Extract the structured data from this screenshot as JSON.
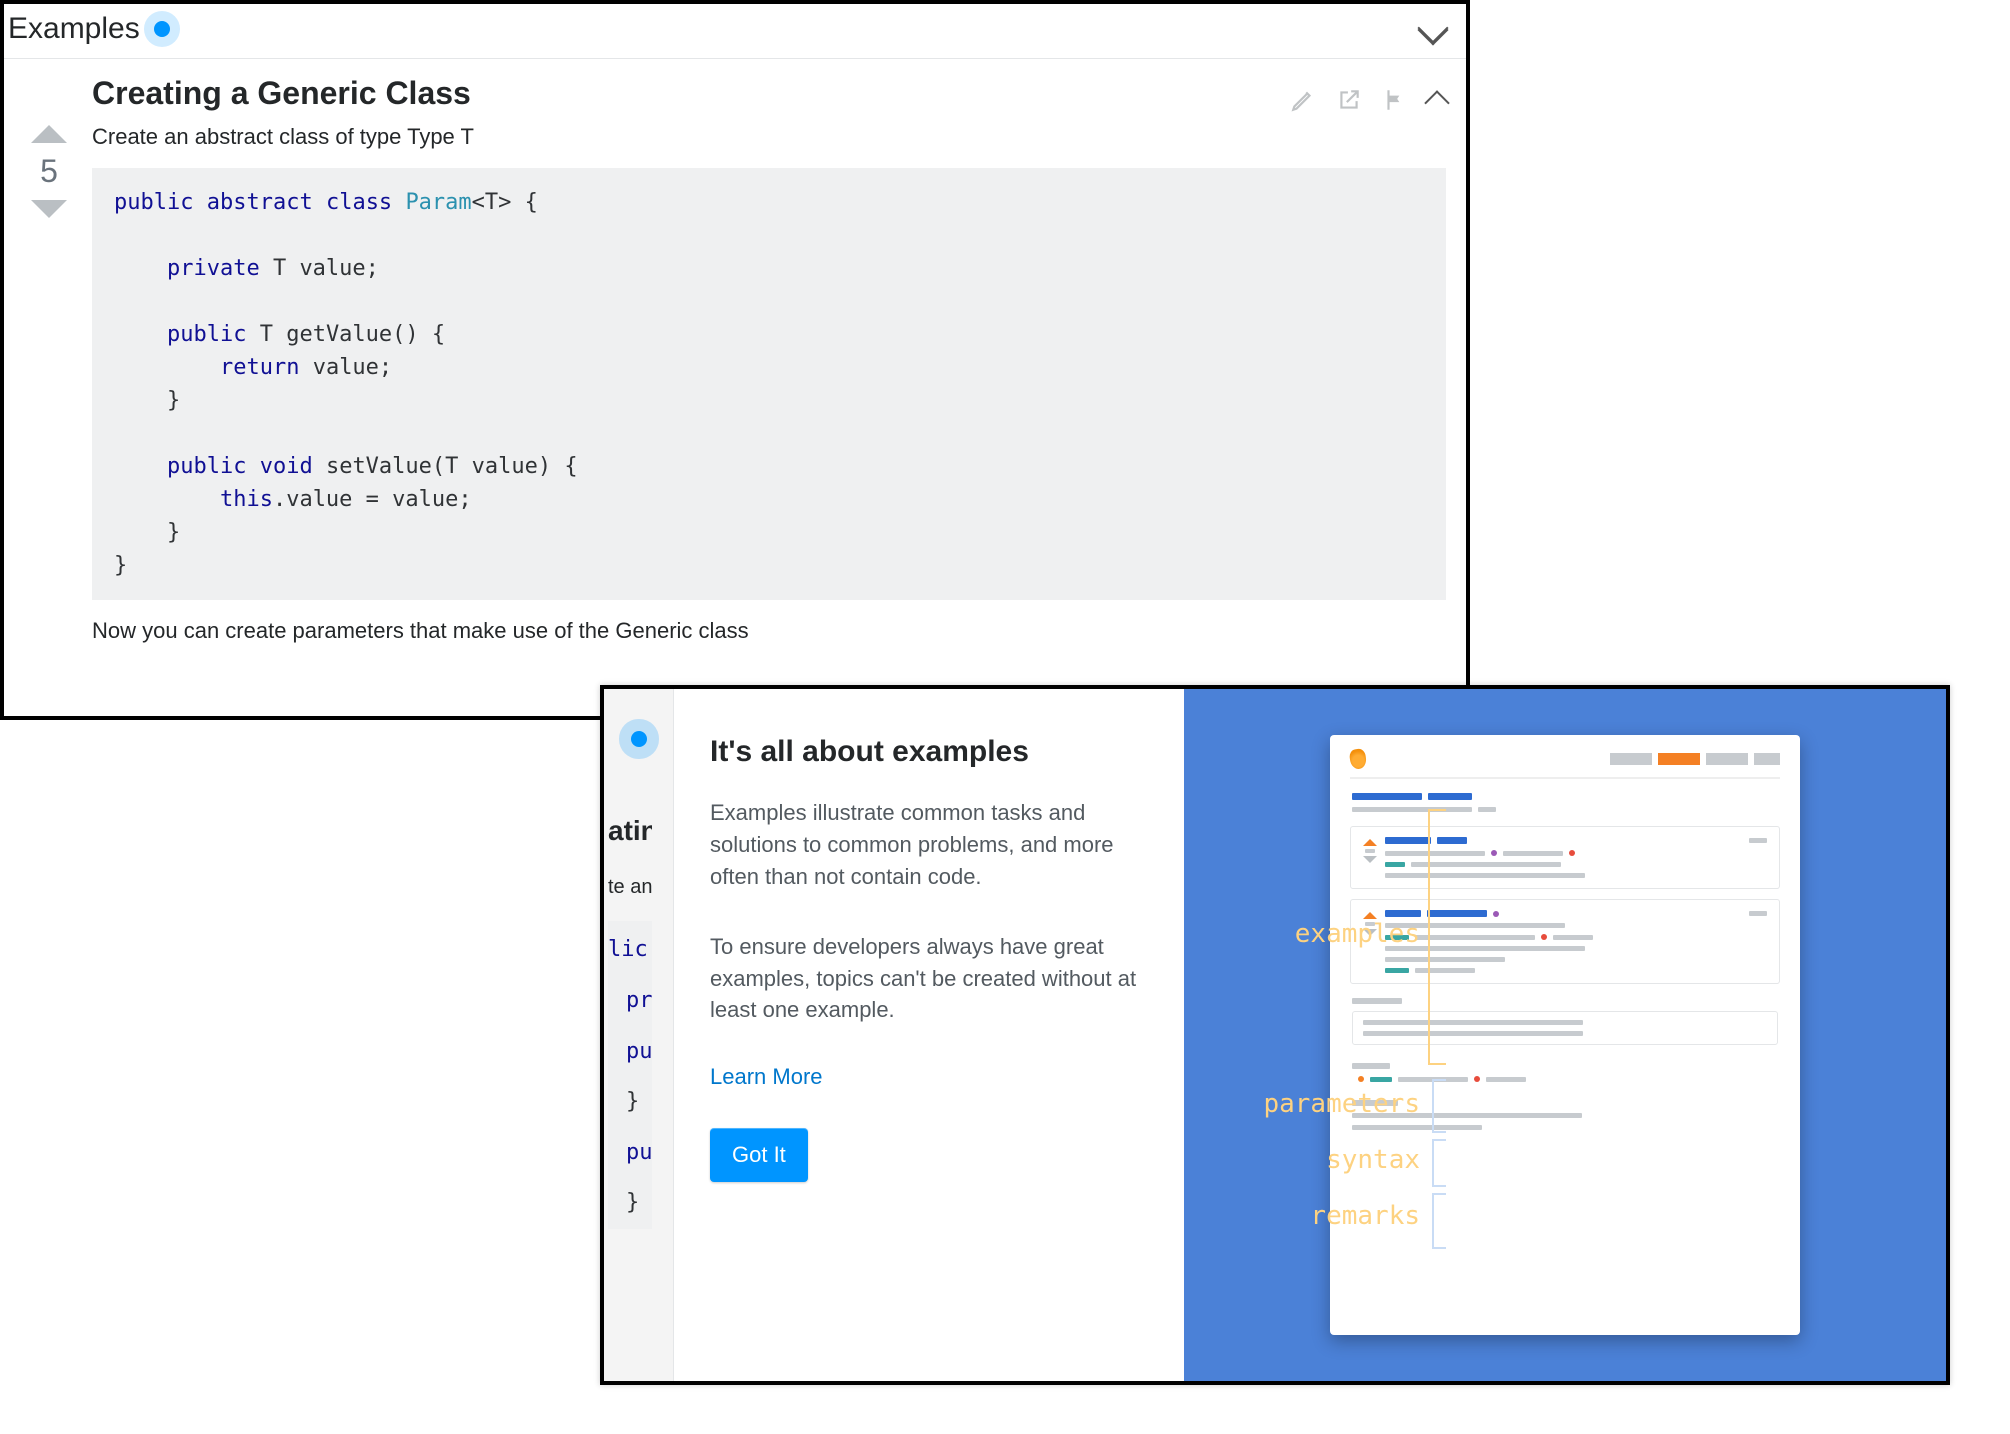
{
  "backPanel": {
    "sectionTitle": "Examples",
    "voteCount": "5",
    "articleTitle": "Creating a Generic Class",
    "articleSubtitle": "Create an abstract class of type Type T",
    "afterCodeText": "Now you can create parameters that make use of the Generic class",
    "code": {
      "l1a": "public",
      "l1b": "abstract",
      "l1c": "class",
      "l1d": "Param",
      "l1e": "<T> {",
      "l2a": "private",
      "l2b": " T value;",
      "l3a": "public",
      "l3b": " T getValue() {",
      "l4a": "return",
      "l4b": " value;",
      "l5": "}",
      "l6a": "public",
      "l6b": "void",
      "l6c": " setValue(T value) {",
      "l7a": "this",
      "l7b": ".value = value;",
      "l8": "}",
      "l9": "}"
    }
  },
  "frontPanel": {
    "peek": {
      "t1": "ating",
      "t2": "te an",
      "c1": "lic",
      "c2": "pri",
      "c3": "pub",
      "c4": "}",
      "c5": "pub",
      "c6": "}"
    },
    "popup": {
      "title": "It's all about examples",
      "p1": "Examples illustrate common tasks and solutions to common problems, and more often than not contain code.",
      "p2": "To ensure developers always have great examples, topics can't be created without at least one example.",
      "learnMore": "Learn More",
      "gotIt": "Got It"
    },
    "illus": {
      "labels": {
        "examples": "examples",
        "parameters": "parameters",
        "syntax": "syntax",
        "remarks": "remarks"
      }
    }
  }
}
